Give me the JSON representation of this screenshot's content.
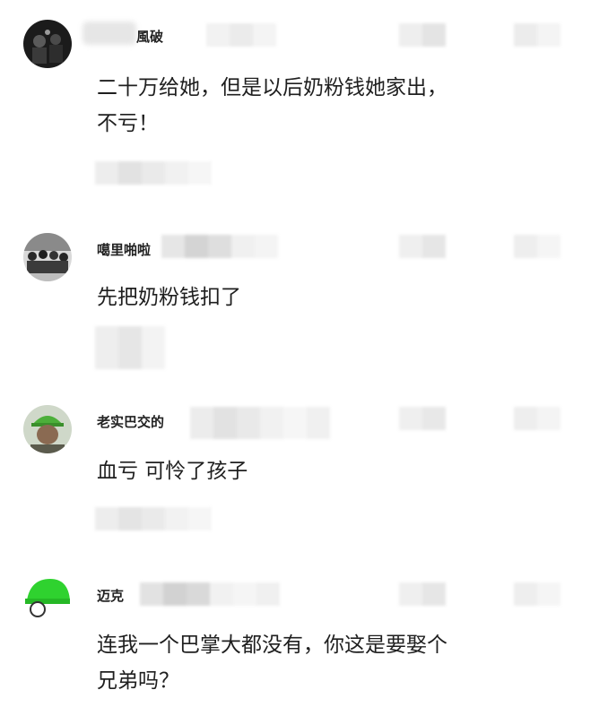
{
  "comments": [
    {
      "username": "風破",
      "username_partially_hidden": true,
      "text": "二十万给她，但是以后奶粉钱她家出，\n不亏！",
      "avatar_icon": "dark-photo-avatar-icon"
    },
    {
      "username": "噶里啪啦",
      "username_partially_hidden": true,
      "text": "先把奶粉钱扣了",
      "avatar_icon": "group-photo-avatar-icon"
    },
    {
      "username": "老实巴交的",
      "username_partially_hidden": true,
      "text": "血亏  可怜了孩子",
      "avatar_icon": "green-helmet-person-avatar-icon"
    },
    {
      "username": "迈克",
      "username_partially_hidden": true,
      "text": "连我一个巴掌大都没有，你这是要娶个\n兄弟吗？",
      "avatar_icon": "green-cap-avatar-icon"
    }
  ],
  "colors": {
    "background": "#ffffff",
    "text": "#1f1f1f",
    "username": "#222222",
    "mosaic_light": "#eeeeee",
    "mosaic_mid": "#d9d9d9",
    "helmet_green": "#2fd22f"
  }
}
